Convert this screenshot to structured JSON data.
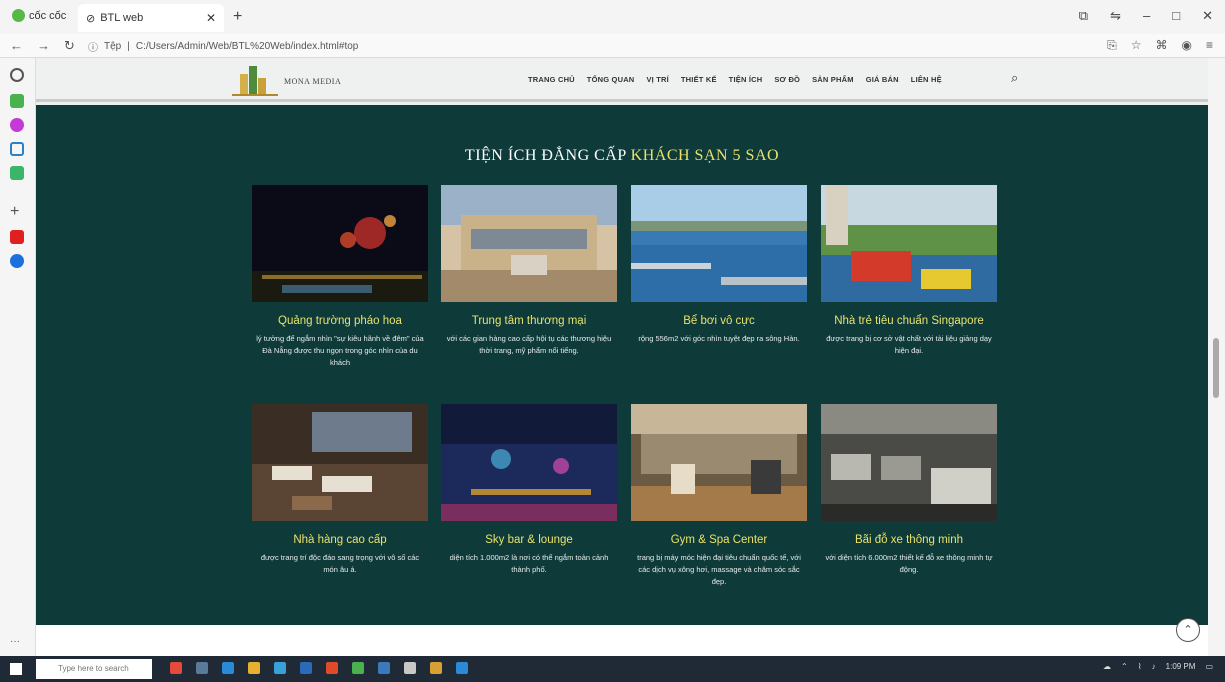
{
  "browser": {
    "brand": "cốc cốc",
    "tab_title": "BTL web",
    "url": "C:/Users/Admin/Web/BTL%20Web/index.html#top",
    "url_prefix": "Tệp"
  },
  "site": {
    "logo_text": "MONA MEDIA",
    "nav": [
      "TRANG CHỦ",
      "TỔNG QUAN",
      "VỊ TRÍ",
      "THIẾT KẾ",
      "TIỆN ÍCH",
      "SƠ ĐỒ",
      "SẢN PHẨM",
      "GIÁ BÁN",
      "LIÊN HỆ"
    ]
  },
  "section": {
    "heading_part1": "TIỆN ÍCH ĐẲNG CẤP ",
    "heading_highlight": "KHÁCH SẠN 5 SAO",
    "cards": [
      {
        "title": "Quảng trường pháo hoa",
        "desc": "lý tưởng để ngắm nhìn \"sự kiêu hãnh về đêm\" của Đà Nẵng được thu ngọn trong góc nhìn của du khách",
        "photo": "fireworks-photo"
      },
      {
        "title": "Trung tâm thương mại",
        "desc": "với các gian hàng cao cấp hội tụ các thương hiệu thời trang, mỹ phẩm nổi tiếng.",
        "photo": "mall-photo"
      },
      {
        "title": "Bể bơi vô cực",
        "desc": "rộng 556m2 với góc nhìn tuyệt đẹp ra sông Hàn.",
        "photo": "pool-photo"
      },
      {
        "title": "Nhà trẻ tiêu chuẩn Singapore",
        "desc": "được trang bị cơ sở vật chất với tài liệu giảng dạy hiện đại.",
        "photo": "playground-photo"
      },
      {
        "title": "Nhà hàng cao cấp",
        "desc": "được trang trí độc đáo sang trọng với vô số các món âu á.",
        "photo": "restaurant-photo"
      },
      {
        "title": "Sky bar & lounge",
        "desc": "diện tích 1.000m2 là nơi có thể ngắm toàn cảnh thành phố.",
        "photo": "skybar-photo"
      },
      {
        "title": "Gym & Spa Center",
        "desc": "trang bị máy móc hiện đại tiêu chuẩn quốc tế, với các dịch vụ xông hơi, massage và chăm sóc sắc đẹp.",
        "photo": "gym-photo"
      },
      {
        "title": "Bãi đỗ xe thông minh",
        "desc": "với diện tích 6.000m2 thiết kế đỗ xe thông minh tự động.",
        "photo": "parking-photo"
      }
    ]
  },
  "taskbar": {
    "search_placeholder": "Type here to search",
    "time": "1:09 PM"
  },
  "colors": {
    "section_bg": "#0f3a3a",
    "highlight": "#e8e26a"
  }
}
